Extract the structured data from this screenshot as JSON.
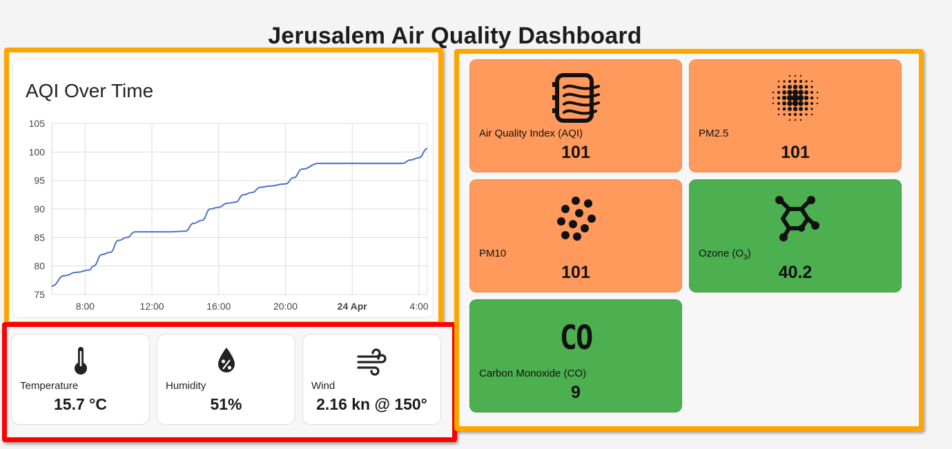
{
  "page": {
    "title": "Jerusalem Air Quality Dashboard"
  },
  "chart_data": {
    "type": "line",
    "title": "AQI Over Time",
    "x_ticks": [
      "8:00",
      "12:00",
      "16:00",
      "20:00",
      "24 Apr",
      "4:00"
    ],
    "y_ticks": [
      "75",
      "80",
      "85",
      "90",
      "95",
      "100",
      "105"
    ],
    "ylim": [
      75,
      105
    ],
    "grid": true,
    "color": "#4a72c9",
    "series": [
      {
        "x": [
          "06:00",
          "06:45",
          "07:30",
          "08:15",
          "08:30",
          "09:00",
          "09:30",
          "10:00",
          "10:30",
          "11:00",
          "12:00",
          "13:00",
          "14:00",
          "14:30",
          "15:00",
          "15:30",
          "16:00",
          "16:30",
          "17:00",
          "17:30",
          "18:00",
          "18:30",
          "19:00",
          "20:00",
          "20:30",
          "21:00",
          "22:00",
          "23:00",
          "00:00",
          "01:00",
          "02:00",
          "03:00",
          "03:30",
          "04:00",
          "04:30"
        ],
        "y": [
          76.5,
          78.3,
          78.9,
          79.3,
          80,
          82,
          82.4,
          84.5,
          85,
          86,
          86,
          86,
          86.1,
          87.5,
          88,
          90,
          90.3,
          91,
          91.2,
          92.5,
          92.9,
          93.8,
          94,
          94.4,
          95.5,
          97,
          98,
          98,
          98,
          98,
          98,
          98,
          98.6,
          99,
          100.6
        ]
      }
    ]
  },
  "environment": {
    "temperature": {
      "label": "Temperature",
      "value": "15.7 °C",
      "icon": "thermometer-icon"
    },
    "humidity": {
      "label": "Humidity",
      "value": "51%",
      "icon": "humidity-drop-icon"
    },
    "wind": {
      "label": "Wind",
      "value": "2.16 kn @ 150°",
      "icon": "wind-icon"
    }
  },
  "pollutants": {
    "aqi": {
      "label": "Air Quality Index (AQI)",
      "value": "101",
      "color": "#ff9a5c",
      "icon": "air-filter-icon"
    },
    "pm25": {
      "label": "PM2.5",
      "value": "101",
      "color": "#ff9a5c",
      "icon": "dots-fine-icon"
    },
    "pm10": {
      "label": "PM10",
      "value": "101",
      "color": "#ff9a5c",
      "icon": "dots-coarse-icon"
    },
    "ozone": {
      "label_main": "Ozone (O",
      "label_sub": "3",
      "label_end": ")",
      "value": "40.2",
      "color": "#4caf50",
      "icon": "molecule-icon"
    },
    "co": {
      "label": "Carbon Monoxide (CO)",
      "value": "9",
      "color": "#4caf50",
      "icon": "co-icon",
      "icon_text": "CO"
    }
  }
}
